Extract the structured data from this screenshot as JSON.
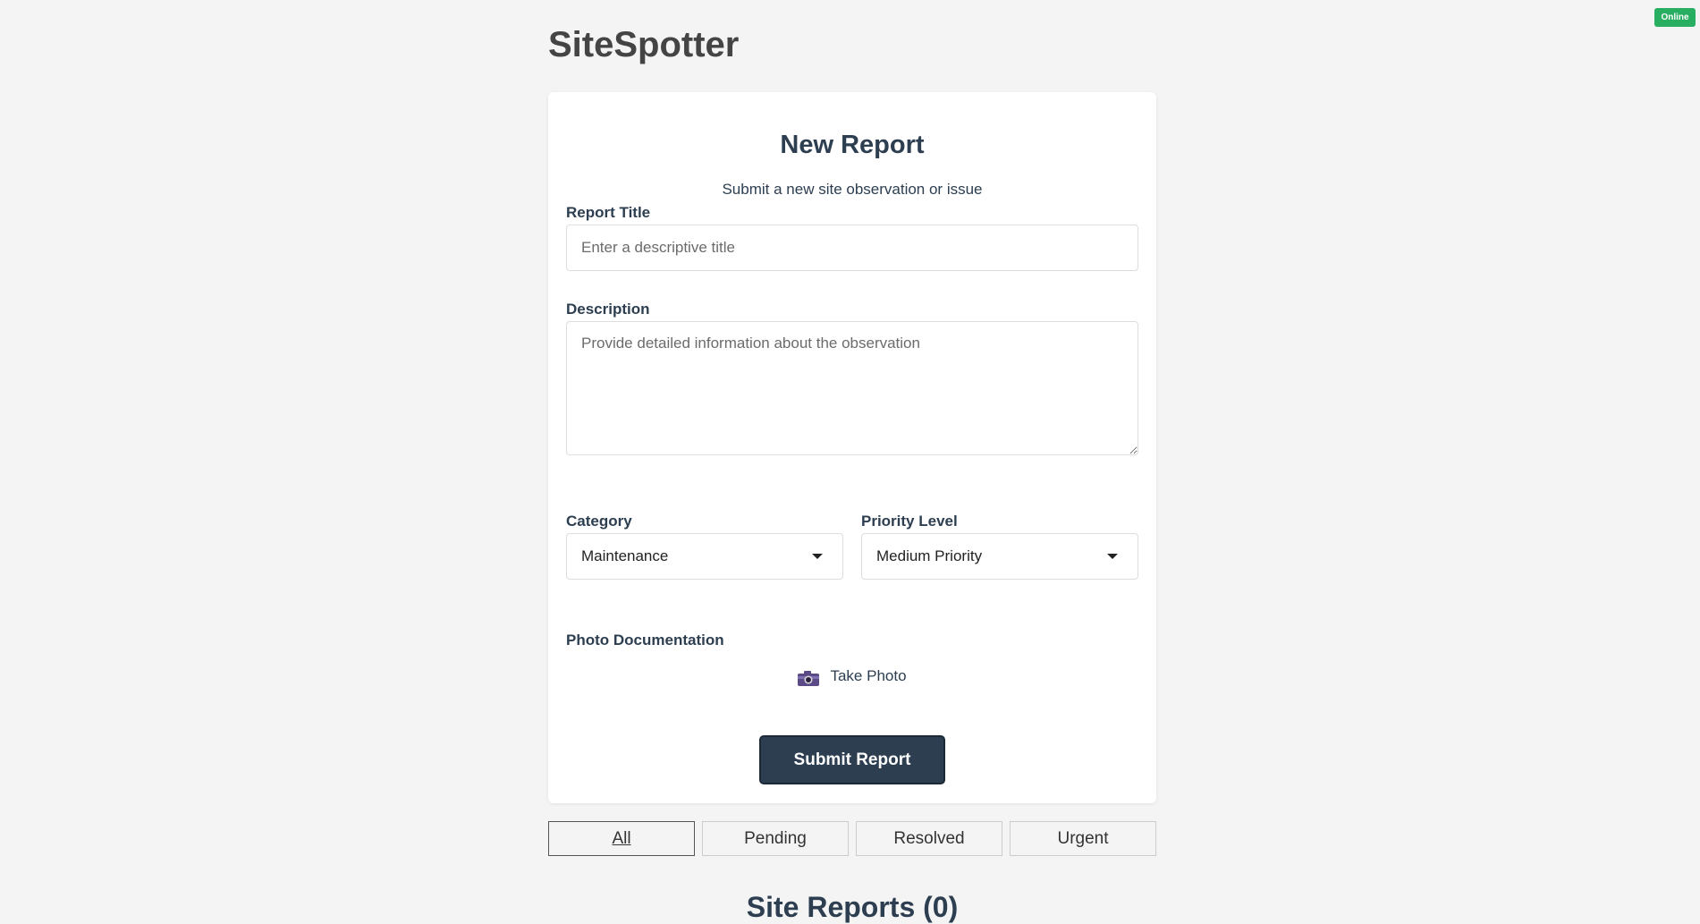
{
  "status_badge": "Online",
  "app_title": "SiteSpotter",
  "form": {
    "title": "New Report",
    "subtitle": "Submit a new site observation or issue",
    "report_title_label": "Report Title",
    "report_title_placeholder": "Enter a descriptive title",
    "description_label": "Description",
    "description_placeholder": "Provide detailed information about the observation",
    "category_label": "Category",
    "category_value": "Maintenance",
    "priority_label": "Priority Level",
    "priority_value": "Medium Priority",
    "photo_label": "Photo Documentation",
    "photo_button": "Take Photo",
    "submit_label": "Submit Report"
  },
  "filters": [
    "All",
    "Pending",
    "Resolved",
    "Urgent"
  ],
  "reports_heading": "Site Reports (0)",
  "colors": {
    "primary": "#2c3e50",
    "online": "#27ae60",
    "background": "#f4f4f4"
  }
}
